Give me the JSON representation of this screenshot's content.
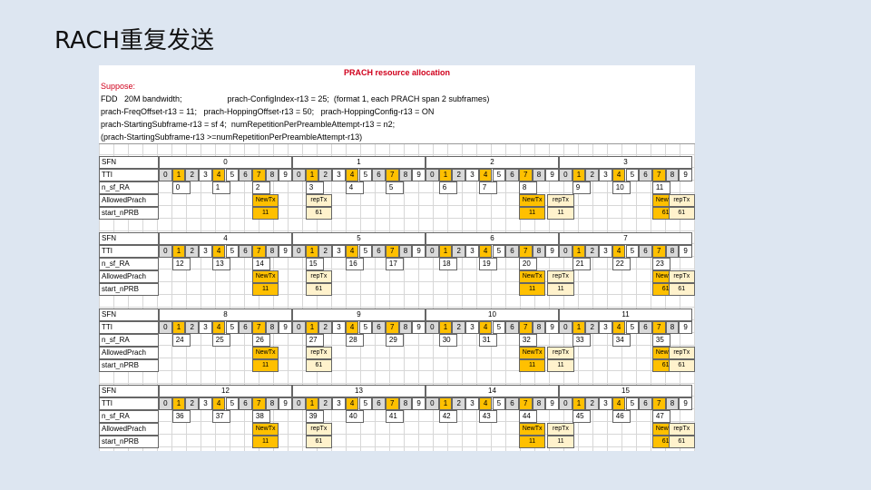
{
  "slide_title": "RACH重复发送",
  "sheet": {
    "title": "PRACH resource allocation",
    "suppose": "Suppose:",
    "lines": [
      "FDD   20M bandwidth;                    prach-ConfigIndex-r13 = 25;  (format 1, each PRACH span 2 subframes)",
      "prach-FreqOffset-r13 = 11;   prach-HoppingOffset-r13 = 50;   prach-HoppingConfig-r13 = ON",
      "prach-StartingSubframe-r13 = sf 4;  numRepetitionPerPreambleAttempt-r13 = n2;",
      "(prach-StartingSubframe-r13 >=numRepetitionPerPreambleAttempt-r13)"
    ],
    "row_labels": [
      "SFN",
      "TTI",
      "n_sf_RA",
      "AllowedPrach",
      "start_nPRB"
    ],
    "tti_values": [
      "0",
      "1",
      "2",
      "3",
      "4",
      "5",
      "6",
      "7",
      "8",
      "9"
    ],
    "newtx_label": "NewTx",
    "reptx_label": "repTx",
    "blocks": [
      {
        "sfn": [
          "0",
          "1",
          "2",
          "3"
        ],
        "nsf": [
          [
            "0",
            "1",
            "2"
          ],
          [
            "3",
            "4",
            "5"
          ],
          [
            "6",
            "7",
            "8"
          ],
          [
            "9",
            "10",
            "11"
          ]
        ],
        "prach": [
          {
            "new": "11",
            "rep": null
          },
          {
            "new": null,
            "rep": "61"
          },
          {
            "new": "11",
            "rep": "11"
          },
          {
            "new": "61",
            "rep": "61"
          }
        ]
      },
      {
        "sfn": [
          "4",
          "5",
          "6",
          "7"
        ],
        "nsf": [
          [
            "12",
            "13",
            "14"
          ],
          [
            "15",
            "16",
            "17"
          ],
          [
            "18",
            "19",
            "20"
          ],
          [
            "21",
            "22",
            "23"
          ]
        ],
        "prach": [
          {
            "new": "11",
            "rep": null
          },
          {
            "new": null,
            "rep": "61"
          },
          {
            "new": "11",
            "rep": "11"
          },
          {
            "new": "61",
            "rep": "61"
          }
        ]
      },
      {
        "sfn": [
          "8",
          "9",
          "10",
          "11"
        ],
        "nsf": [
          [
            "24",
            "25",
            "26"
          ],
          [
            "27",
            "28",
            "29"
          ],
          [
            "30",
            "31",
            "32"
          ],
          [
            "33",
            "34",
            "35"
          ]
        ],
        "prach": [
          {
            "new": "11",
            "rep": null
          },
          {
            "new": null,
            "rep": "61"
          },
          {
            "new": "11",
            "rep": "11"
          },
          {
            "new": "61",
            "rep": "61"
          }
        ]
      },
      {
        "sfn": [
          "12",
          "13",
          "14",
          "15"
        ],
        "nsf": [
          [
            "36",
            "37",
            "38"
          ],
          [
            "39",
            "40",
            "41"
          ],
          [
            "42",
            "43",
            "44"
          ],
          [
            "45",
            "46",
            "47"
          ]
        ],
        "prach": [
          {
            "new": "11",
            "rep": null
          },
          {
            "new": null,
            "rep": "61"
          },
          {
            "new": "11",
            "rep": "11"
          },
          {
            "new": "61",
            "rep": "61"
          }
        ]
      }
    ]
  }
}
